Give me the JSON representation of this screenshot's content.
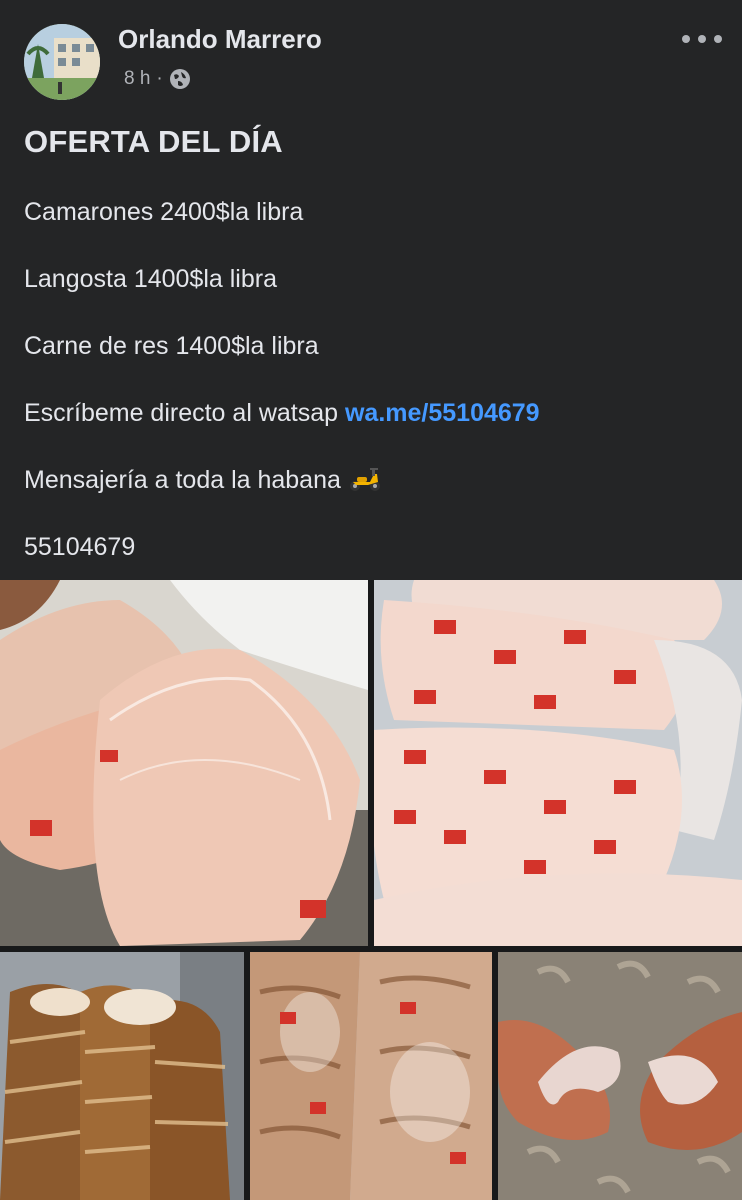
{
  "post": {
    "author": "Orlando Marrero",
    "time": "8 h",
    "separator": "·",
    "privacy_icon": "globe-icon",
    "more_icon": "more-horizontal-icon",
    "title": "OFERTA DEL DÍA",
    "lines": [
      "Camarones 2400$la libra",
      "Langosta 1400$la libra",
      "Carne de res 1400$la libra"
    ],
    "contact_text": "Escríbeme directo al watsap ",
    "contact_link": "wa.me/55104679",
    "delivery_text": "Mensajería a toda la habana ",
    "delivery_icon": "scooter-emoji",
    "phone": "55104679"
  },
  "photos": [
    {
      "subject": "shrimp-bags-photo"
    },
    {
      "subject": "cuba-shrimp-bags-photo"
    },
    {
      "subject": "lobster-tails-photo"
    },
    {
      "subject": "lobster-bags-photo"
    },
    {
      "subject": "shrimp-in-hands-photo"
    }
  ],
  "colors": {
    "background": "#242526",
    "text": "#e4e6eb",
    "secondary_text": "#b0b3b8",
    "link": "#4599ff"
  }
}
